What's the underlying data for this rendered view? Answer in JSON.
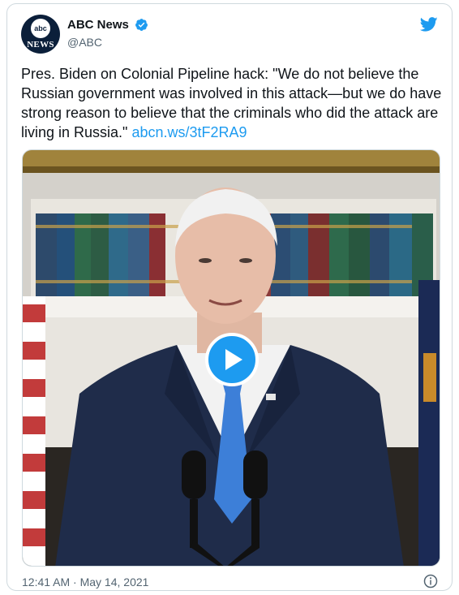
{
  "author": {
    "display_name": "ABC News",
    "handle": "@ABC",
    "avatar_small_text": "abc",
    "avatar_word": "NEWS",
    "verified_icon": "verified-badge-icon"
  },
  "tweet": {
    "text": "Pres. Biden on Colonial Pipeline hack: \"We do not believe the Russian government was involved in this attack—but we do have strong reason to believe that the criminals who did the attack are living in Russia.\" ",
    "link": "abcn.ws/3tF2RA9"
  },
  "media": {
    "type": "video",
    "play_icon": "play-icon"
  },
  "footer": {
    "timestamp": "12:41 AM · May 14, 2021",
    "info_icon": "info-icon"
  },
  "colors": {
    "accent": "#1d9bf0",
    "text": "#0f1419",
    "muted": "#536471",
    "border": "#cfd9de"
  }
}
